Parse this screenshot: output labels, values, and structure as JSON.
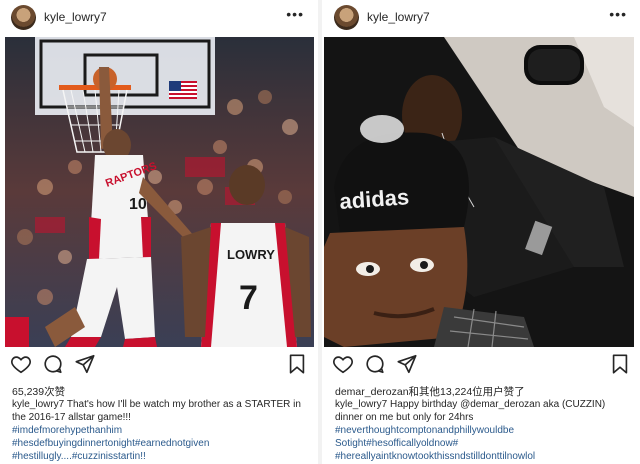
{
  "left_post": {
    "username": "kyle_lowry7",
    "more_label": "•••",
    "jersey_left": "RAPTORS",
    "jersey_left_number": "10",
    "jersey_right": "LOWRY",
    "jersey_right_number": "7",
    "likes": "65,239次赞",
    "caption_user": "kyle_lowry7",
    "caption_text": "That's how I'll be watch my brother as a STARTER in the 2016-17 allstar game!!!",
    "hashtags": [
      "#imdefmorehypethanhim",
      "#hesdefbuyingdinnertonight#earnednotgiven",
      "#hestillugly....#cuzzinisstartin!!"
    ]
  },
  "right_post": {
    "username": "kyle_lowry7",
    "more_label": "•••",
    "hat_text": "adidas",
    "likes": "demar_derozan和其他13,224位用户赞了",
    "caption_user": "kyle_lowry7",
    "caption_text": "Happy birthday @demar_derozan aka (CUZZIN) dinner on me but only for 24hrs",
    "hashtags": [
      "#neverthoughtcomptonandphillywouldbe",
      "Sotight#hesofficallyoldnow#",
      "#hereallyaintknowtookthissndstilldonttilnowlol"
    ]
  },
  "icons": [
    "heart-icon",
    "comment-icon",
    "share-icon",
    "bookmark-icon",
    "more-icon"
  ],
  "colors": {
    "raptors_red": "#c8102e",
    "hashtag_blue": "#2b5a8c",
    "text": "#262626"
  }
}
